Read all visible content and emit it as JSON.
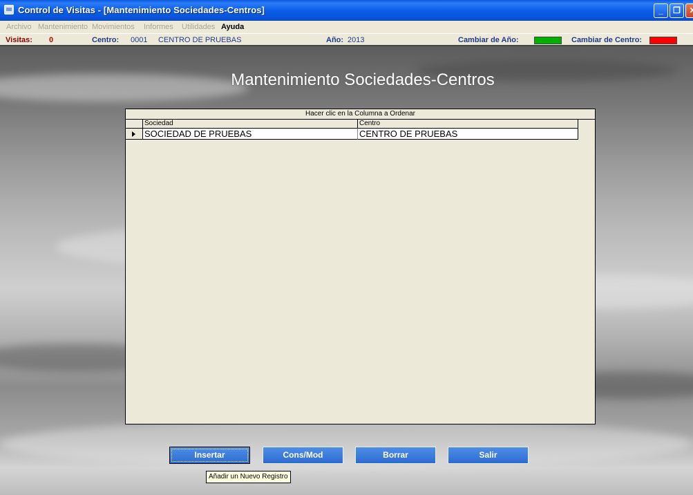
{
  "window": {
    "title": "Control de Visitas - [Mantenimiento Sociedades-Centros]"
  },
  "menu": {
    "items": [
      "Archivo",
      "Mantenimiento",
      "Movimientos",
      "Informes",
      "Utilidades",
      "Ayuda"
    ]
  },
  "status": {
    "visitas_label": "Visitas:",
    "visitas_value": "0",
    "centro_label": "Centro:",
    "centro_code": "0001",
    "centro_name": "CENTRO DE PRUEBAS",
    "anio_label": "Año:",
    "anio_value": "2013",
    "cambiar_anio_label": "Cambiar de Año:",
    "cambiar_anio_color": "#00b000",
    "cambiar_centro_label": "Cambiar de Centro:",
    "cambiar_centro_color": "#ff0000"
  },
  "page": {
    "title": "Mantenimiento Sociedades-Centros"
  },
  "grid": {
    "caption": "Hacer clic en la Columna a Ordenar",
    "columns": [
      "Sociedad",
      "Centro"
    ],
    "rows": [
      [
        "SOCIEDAD DE PRUEBAS",
        "CENTRO DE PRUEBAS"
      ]
    ]
  },
  "buttons": {
    "insertar": "Insertar",
    "consmod": "Cons/Mod",
    "borrar": "Borrar",
    "salir": "Salir"
  },
  "tooltip": {
    "text": "Añadir un Nuevo Registro"
  }
}
